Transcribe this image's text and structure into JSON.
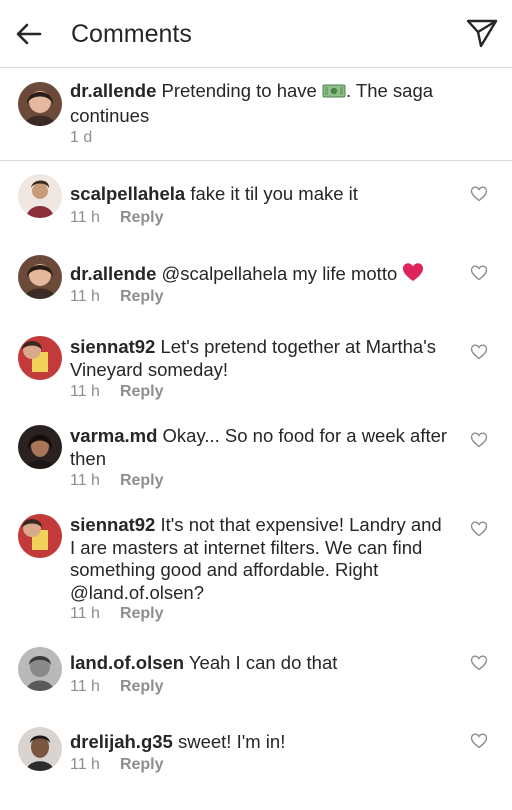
{
  "header": {
    "title": "Comments",
    "back_icon": "arrow-left-icon",
    "share_icon": "paper-plane-icon"
  },
  "caption": {
    "username": "dr.allende",
    "text_before": " Pretending to have ",
    "emoji": "money-emoji",
    "text_after": ". The saga continues",
    "time": "1 d"
  },
  "comments": [
    {
      "username": "scalpellahela",
      "text": " fake it til you make it",
      "time": "11 h",
      "reply": "Reply"
    },
    {
      "username": "dr.allende",
      "text": " @scalpellahela my life motto ",
      "emoji": "red-heart-emoji",
      "time": "11 h",
      "reply": "Reply"
    },
    {
      "username": "siennat92",
      "text": " Let's pretend together at Martha's Vineyard someday!",
      "time": "11 h",
      "reply": "Reply"
    },
    {
      "username": "varma.md",
      "text": " Okay... So no food for a week after then",
      "time": "11 h",
      "reply": "Reply"
    },
    {
      "username": "siennat92",
      "text": " It's not that expensive! Landry and I are masters at internet filters. We can find something good and affordable. Right @land.of.olsen?",
      "time": "11 h",
      "reply": "Reply"
    },
    {
      "username": "land.of.olsen",
      "text": " Yeah I can do that",
      "time": "11 h",
      "reply": "Reply"
    },
    {
      "username": "drelijah.g35",
      "text": " sweet! I'm in!",
      "time": "11 h",
      "reply": "Reply"
    }
  ],
  "colors": {
    "text": "#262626",
    "secondary": "#8e8e8e",
    "divider": "#dbdbdb",
    "heart": "#e0245e"
  }
}
